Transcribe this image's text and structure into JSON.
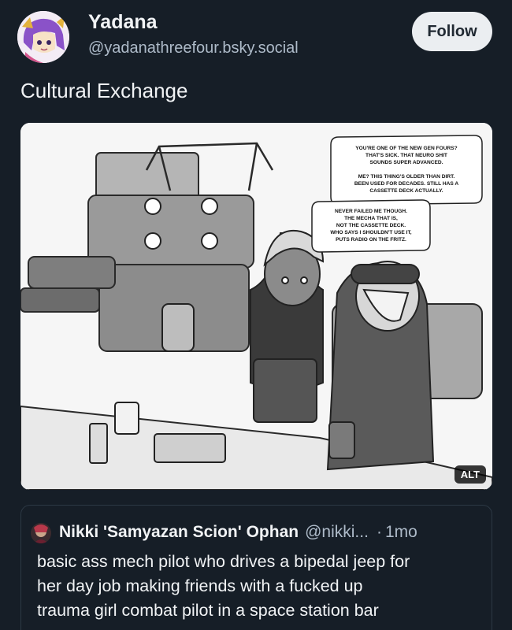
{
  "author": {
    "name": "Yadana",
    "handle": "@yadanathreefour.bsky.social",
    "avatar_icon": "avatar-illustration"
  },
  "follow_label": "Follow",
  "post": {
    "text": "Cultural Exchange",
    "image": {
      "alt_label": "ALT",
      "speech_bubbles": [
        [
          "YOU'RE ONE OF THE NEW GEN FOURS?",
          "THAT'S SICK. THAT NEURO SHIT",
          "SOUNDS SUPER ADVANCED."
        ],
        [
          "ME? THIS THING'S OLDER THAN DIRT.",
          "BEEN USED FOR DECADES. STILL HAS A",
          "CASSETTE DECK ACTUALLY."
        ],
        [
          "NEVER FAILED ME THOUGH.",
          "THE MECHA THAT IS,",
          "NOT THE CASSETTE DECK.",
          "WHO SAYS I SHOULDN'T USE IT,",
          "PUTS RADIO ON THE FRITZ."
        ]
      ]
    }
  },
  "quote": {
    "name": "Nikki 'Samyazan Scion' Ophan",
    "handle": "@nikki...",
    "separator": "·",
    "time": "1mo",
    "lines": [
      "basic ass mech pilot who drives a bipedal jeep for",
      "her day job making friends with a fucked up",
      "trauma girl combat pilot in a space station bar"
    ]
  },
  "colors": {
    "background": "#161e27",
    "text_primary": "#f1f3f5",
    "text_secondary": "#aebbc9",
    "follow_bg": "#ebeef1",
    "card_border": "#2c3844"
  }
}
